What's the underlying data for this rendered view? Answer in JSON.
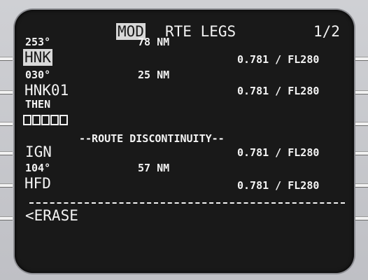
{
  "page": {
    "mod_label": "MOD",
    "title": "RTE LEGS",
    "page_number": "1/2"
  },
  "legs": [
    {
      "course": "253°",
      "distance": "78 NM",
      "waypoint": "HNK",
      "speed_alt": "0.781 / FL280"
    },
    {
      "course": "030°",
      "distance": "25 NM",
      "waypoint": "HNK01",
      "speed_alt": "0.781 / FL280"
    },
    {
      "course": "THEN",
      "distance": "",
      "waypoint": "",
      "speed_alt": ""
    },
    {
      "course": "104°",
      "distance": "57 NM",
      "waypoint": "IGN",
      "speed_alt": "0.781 / FL280"
    },
    {
      "course": "",
      "distance": "",
      "waypoint": "HFD",
      "speed_alt": "0.781 / FL280"
    }
  ],
  "discontinuity": "--ROUTE DISCONTINUITY--",
  "erase_prompt": "<ERASE",
  "colors": {
    "screen_bg": "#191919",
    "text": "#f3f3f3",
    "highlight": "#d8d8d8",
    "bezel": "#c7c8cc"
  }
}
